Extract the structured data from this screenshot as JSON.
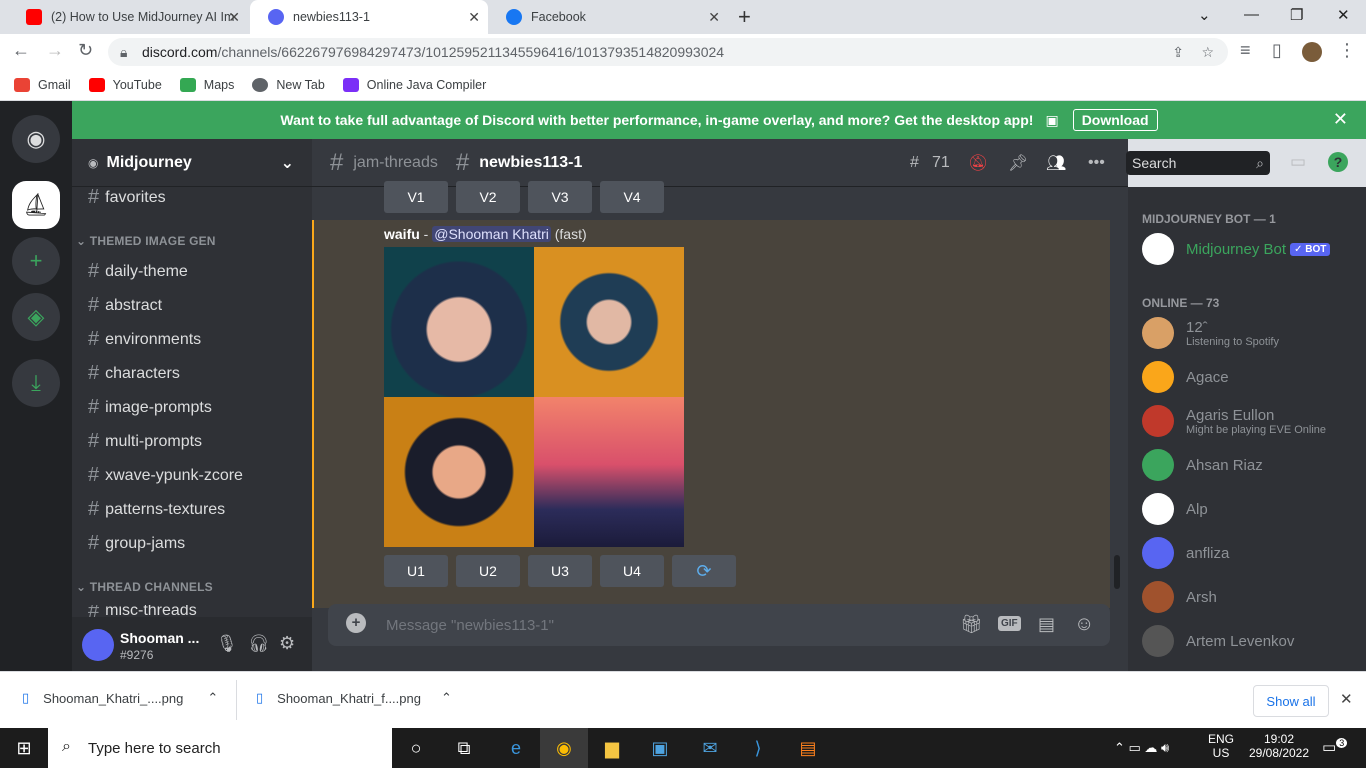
{
  "browser": {
    "tabs": [
      {
        "title": "(2) How to Use MidJourney AI Im",
        "icon": "youtube-icon",
        "color": "#ff0000"
      },
      {
        "title": "newbies113-1",
        "icon": "discord-icon",
        "color": "#5865f2"
      },
      {
        "title": "Facebook",
        "icon": "facebook-icon",
        "color": "#1877f2"
      }
    ],
    "url_host": "discord.com",
    "url_path": "/channels/662267976984297473/1012595211345596416/1013793514820993024",
    "bookmarks": [
      {
        "label": "Gmail",
        "color": "#ea4335"
      },
      {
        "label": "YouTube",
        "color": "#ff0000"
      },
      {
        "label": "Maps",
        "color": "#34a853"
      },
      {
        "label": "New Tab",
        "color": "#5f6368"
      },
      {
        "label": "Online Java Compiler",
        "color": "#7b2ff7"
      }
    ]
  },
  "banner": {
    "text": "Want to take full advantage of Discord with better performance, in-game overlay, and more? Get the desktop app!",
    "button": "Download"
  },
  "sidebar": {
    "server_name": "Midjourney",
    "top_channel": "favorites",
    "category1": "THEMED IMAGE GEN",
    "channels": [
      "daily-theme",
      "abstract",
      "environments",
      "characters",
      "image-prompts",
      "multi-prompts",
      "xwave-ypunk-zcore",
      "patterns-textures",
      "group-jams"
    ],
    "category2": "THREAD CHANNELS",
    "bottom_channel": "misc-threads"
  },
  "user": {
    "name": "Shooman ...",
    "tag": "#9276"
  },
  "header": {
    "parent": "jam-threads",
    "channel": "newbies113-1",
    "thread_count": "71",
    "search_placeholder": "Search"
  },
  "message": {
    "top_buttons": [
      "V1",
      "V2",
      "V3",
      "V4"
    ],
    "prompt": "waifu",
    "separator": " - ",
    "mention": "@Shooman Khatri",
    "mode": "(fast)",
    "bottom_buttons": [
      "U1",
      "U2",
      "U3",
      "U4"
    ],
    "reroll_icon": "refresh-icon"
  },
  "composer": {
    "placeholder": "Message \"newbies113-1\"",
    "gif_label": "GIF"
  },
  "members": {
    "bot_header": "MIDJOURNEY BOT — 1",
    "bot_name": "Midjourney Bot",
    "bot_badge": "✓ BOT",
    "online_header": "ONLINE — 73",
    "list": [
      {
        "name": "12ˆ",
        "sub": "Listening to Spotify",
        "color": "#d9a066"
      },
      {
        "name": "Agace",
        "sub": "",
        "color": "#faa61a"
      },
      {
        "name": "Agaris Eullon",
        "sub": "Might be playing EVE Online",
        "color": "#c0392b"
      },
      {
        "name": "Ahsan Riaz",
        "sub": "",
        "color": "#3ba55d"
      },
      {
        "name": "Alp",
        "sub": "",
        "color": "#ffffff"
      },
      {
        "name": "anfliza",
        "sub": "",
        "color": "#5865f2"
      },
      {
        "name": "Arsh",
        "sub": "",
        "color": "#a0522d"
      },
      {
        "name": "Artem Levenkov",
        "sub": "",
        "color": "#555555"
      }
    ]
  },
  "downloads": {
    "items": [
      "Shooman_Khatri_....png",
      "Shooman_Khatri_f....png"
    ],
    "show_all": "Show all"
  },
  "taskbar": {
    "search_placeholder": "Type here to search",
    "lang": "ENG",
    "region": "US",
    "time": "19:02",
    "date": "29/08/2022",
    "notif_count": "3"
  }
}
